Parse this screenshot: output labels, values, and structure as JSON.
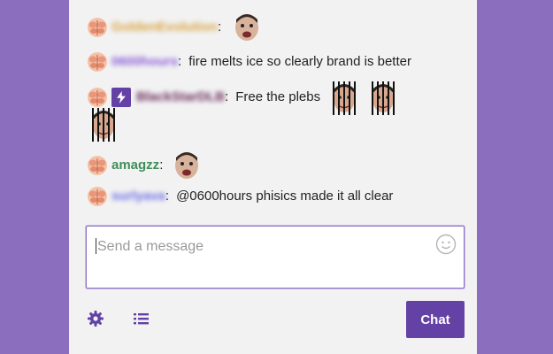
{
  "colors": {
    "background": "#8b6fbe",
    "panel": "#f2f2f3",
    "accent": "#6441a5",
    "name_gold": "#d9a441",
    "name_purple": "#8a5cd6",
    "name_plum": "#6a2a58",
    "name_green": "#3f8f5a",
    "name_blue": "#6d6de6"
  },
  "messages": [
    {
      "username": "GoldenEvolution",
      "username_blurred": true,
      "text": "",
      "emotes": [
        "face-emote"
      ]
    },
    {
      "username": "0600hours",
      "username_blurred": true,
      "text": "fire melts ice so clearly brand is better",
      "emotes": []
    },
    {
      "username": "BlackStarDLB",
      "username_blurred": true,
      "text": "Free the plebs",
      "emotes": [
        "jail-emote",
        "jail-emote",
        "jail-emote"
      ],
      "turbo_badge": true
    },
    {
      "username": "amagzz",
      "username_blurred": false,
      "text": "",
      "emotes": [
        "face-emote"
      ]
    },
    {
      "username": "surlyava",
      "username_blurred": true,
      "text": "@0600hours phisics made it all clear",
      "emotes": []
    }
  ],
  "composer": {
    "placeholder": "Send a message",
    "emoji_icon": "smiley-icon"
  },
  "footer": {
    "settings_icon": "gear-icon",
    "viewer_list_icon": "list-icon",
    "chat_button_label": "Chat"
  }
}
